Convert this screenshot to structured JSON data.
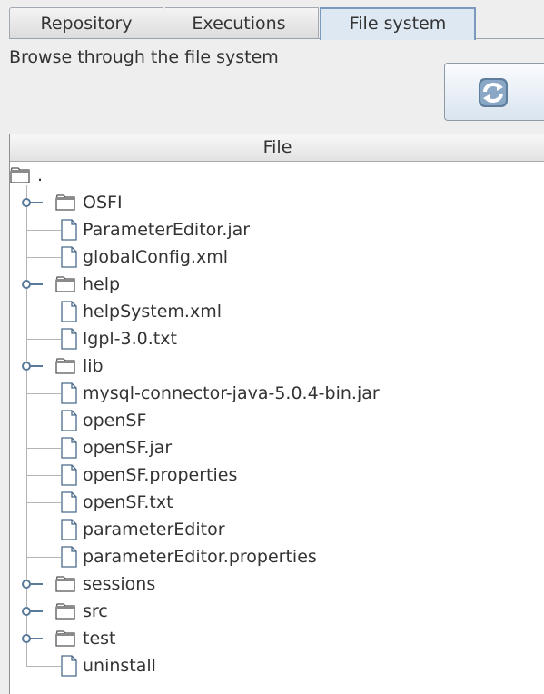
{
  "tabs": [
    {
      "label": "Repository",
      "selected": false
    },
    {
      "label": "Executions",
      "selected": false
    },
    {
      "label": "File system",
      "selected": true
    }
  ],
  "header": {
    "description": "Browse through the file system",
    "refresh_icon": "refresh-icon"
  },
  "table": {
    "column_header": "File",
    "root_label": ".",
    "items": [
      {
        "name": "OSFI",
        "type": "folder",
        "expandable": true
      },
      {
        "name": "ParameterEditor.jar",
        "type": "file"
      },
      {
        "name": "globalConfig.xml",
        "type": "file"
      },
      {
        "name": "help",
        "type": "folder",
        "expandable": true
      },
      {
        "name": "helpSystem.xml",
        "type": "file"
      },
      {
        "name": "lgpl-3.0.txt",
        "type": "file"
      },
      {
        "name": "lib",
        "type": "folder",
        "expandable": true
      },
      {
        "name": "mysql-connector-java-5.0.4-bin.jar",
        "type": "file"
      },
      {
        "name": "openSF",
        "type": "file"
      },
      {
        "name": "openSF.jar",
        "type": "file"
      },
      {
        "name": "openSF.properties",
        "type": "file"
      },
      {
        "name": "openSF.txt",
        "type": "file"
      },
      {
        "name": "parameterEditor",
        "type": "file"
      },
      {
        "name": "parameterEditor.properties",
        "type": "file"
      },
      {
        "name": "sessions",
        "type": "folder",
        "expandable": true
      },
      {
        "name": "src",
        "type": "folder",
        "expandable": true
      },
      {
        "name": "test",
        "type": "folder",
        "expandable": true
      },
      {
        "name": "uninstall",
        "type": "file"
      }
    ]
  },
  "colors": {
    "selected_tab_bg": "#dde8f3",
    "selected_tab_border": "#7a99bd",
    "tree_line": "#b4b4b4"
  }
}
